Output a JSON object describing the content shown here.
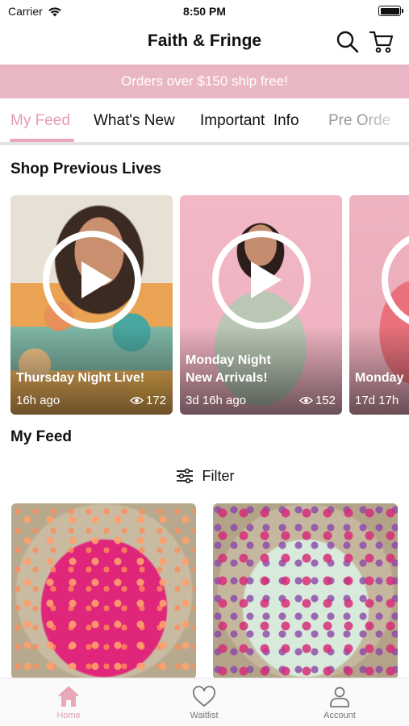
{
  "status_bar": {
    "carrier": "Carrier",
    "time": "8:50 PM",
    "battery_level": 1.0
  },
  "header": {
    "title": "Faith & Fringe",
    "search_icon": "search-icon",
    "cart_icon": "cart-icon"
  },
  "promo": {
    "text": "Orders over $150 ship free!"
  },
  "tabs": [
    {
      "label": "My Feed",
      "active": true
    },
    {
      "label": "What's New"
    },
    {
      "label": "Important  Info"
    },
    {
      "label": "Pre Orde"
    }
  ],
  "colors": {
    "accent": "#e39db0",
    "banner": "#e9b7c3"
  },
  "previous_lives": {
    "title": "Shop Previous Lives",
    "items": [
      {
        "title": "Thursday Night Live!",
        "ago": "16h ago",
        "views": "172"
      },
      {
        "title": "Monday Night\nNew Arrivals!",
        "ago": "3d 16h ago",
        "views": "152"
      },
      {
        "title": "Monday",
        "ago": "17d 17h"
      }
    ]
  },
  "feed": {
    "title": "My Feed",
    "filter_label": "Filter"
  },
  "tabbar": [
    {
      "label": "Home",
      "icon": "home-icon",
      "active": true
    },
    {
      "label": "Waitlist",
      "icon": "heart-icon"
    },
    {
      "label": "Account",
      "icon": "person-icon"
    }
  ]
}
